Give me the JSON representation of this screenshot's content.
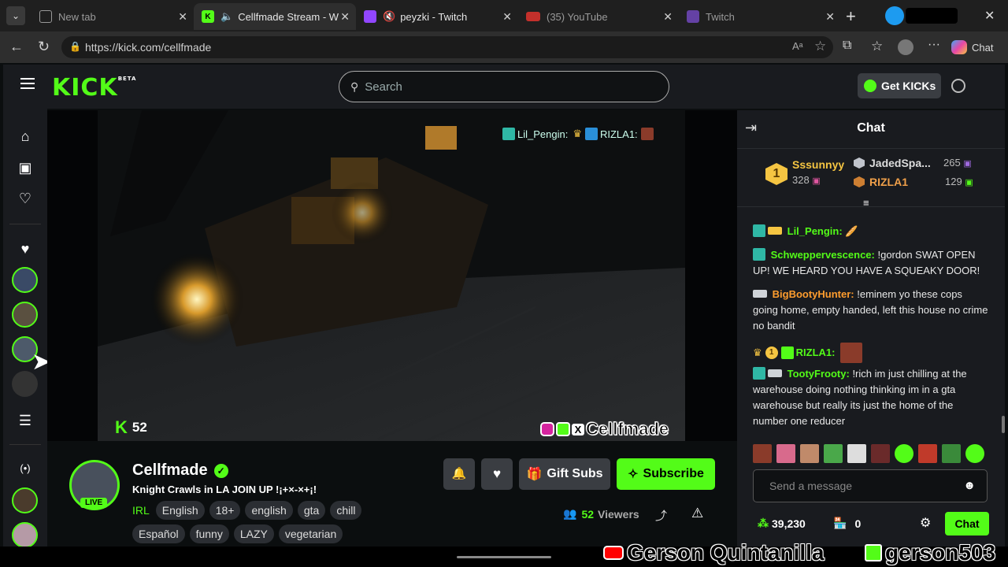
{
  "browser": {
    "tabs": [
      {
        "label": "New tab",
        "active": false
      },
      {
        "label": "Cellfmade Stream - Wat",
        "active": true
      },
      {
        "label": "peyzki - Twitch",
        "active": false
      },
      {
        "label": "(35) YouTube",
        "active": false
      },
      {
        "label": "Twitch",
        "active": false
      }
    ],
    "url": "https://kick.com/cellfmade",
    "chat_button": "Chat"
  },
  "header": {
    "logo": "KICK",
    "logo_tag": "BETA",
    "search_placeholder": "Search",
    "get_kicks": "Get KICKs"
  },
  "video": {
    "overlay_chat_user": "Lil_Pengin:",
    "overlay_chat_user2": "RIZLA1:",
    "viewer_count_overlay": "52",
    "watermark": "Cellfmade"
  },
  "stream": {
    "channel": "Cellfmade",
    "live_label": "LIVE",
    "title": "Knight Crawls in LA JOIN UP !¡+×-×+¡!",
    "category": "IRL",
    "tags_row1": [
      "English",
      "18+",
      "english",
      "gta",
      "chill"
    ],
    "tags_row2": [
      "Español",
      "funny",
      "LAZY",
      "vegetarian"
    ],
    "gift_subs": "Gift Subs",
    "subscribe": "Subscribe",
    "viewers_count": "52",
    "viewers_label": "Viewers"
  },
  "chat": {
    "title": "Chat",
    "leaderboard": {
      "first_name": "Sssunnyy",
      "first_count": "328",
      "second_name": "JadedSpa...",
      "second_count": "265",
      "third_name": "RIZLA1",
      "third_count": "129"
    },
    "messages": [
      {
        "user": "Lil_Pengin:",
        "text": "",
        "color": "#53fc18"
      },
      {
        "user": "Schweppervescence:",
        "text": "!gordon SWAT OPEN UP! WE HEARD YOU HAVE A SQUEAKY DOOR!",
        "color": "#53fc18"
      },
      {
        "user": "BigBootyHunter:",
        "text": "!eminem yo these cops going home, empty handed, left this house no crime no bandit",
        "color": "#ff9d2e"
      },
      {
        "user": "RIZLA1:",
        "text": "",
        "color": "#53fc18"
      },
      {
        "user": "TootyFrooty:",
        "text": "!rich im just chilling at the warehouse doing nothing thinking im in a gta warehouse but really its just the home of the number one reducer",
        "color": "#53fc18"
      }
    ],
    "input_placeholder": "Send a message",
    "points": "39,230",
    "store_count": "0",
    "chat_button": "Chat"
  },
  "overlay_bottom": {
    "youtube_name": "Gerson Quintanilla",
    "kick_name": "gerson503"
  },
  "colors": {
    "kick_green": "#53fc18",
    "panel": "#191b1f",
    "background": "#0b0e0f"
  }
}
